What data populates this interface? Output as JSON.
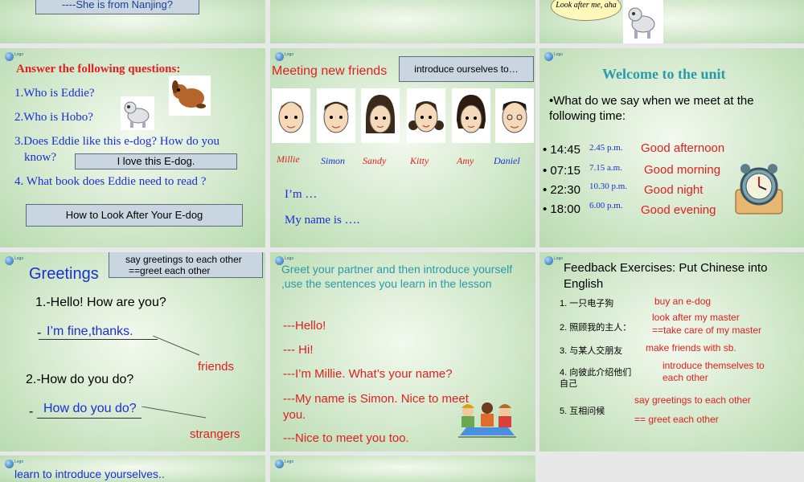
{
  "row0": {
    "s1_line": "----She is  from Nanjing?",
    "s3_bubble": "Look after me, aha"
  },
  "slide_questions": {
    "title": "Answer the following questions:",
    "q1": "1.Who is Eddie?",
    "q2": "2.Who is Hobo?",
    "q3a": "3.Does Eddie like this e-dog? How do you",
    "q3b": "know?",
    "q3_answer": "I love this E-dog.",
    "q4": "4. What book does Eddie need to read ?",
    "q4_answer": "How to Look After Your E-dog"
  },
  "slide_friends": {
    "title": "Meeting new friends",
    "box": "introduce ourselves to…",
    "names": [
      "Millie",
      "Simon",
      "Sandy",
      "Kitty",
      "Amy",
      "Daniel"
    ],
    "line1": "I’m …",
    "line2": "My name is …."
  },
  "slide_welcome": {
    "title": "Welcome to the unit",
    "question": "•What do we say when we meet at the following time:",
    "times": [
      {
        "time": "14:45",
        "note": "2.45 p.m.",
        "greeting": "Good afternoon"
      },
      {
        "time": "07:15",
        "note": "7.15 a.m.",
        "greeting": "Good morning"
      },
      {
        "time": "22:30",
        "note": "10.30 p.m.",
        "greeting": "Good night"
      },
      {
        "time": "18:00",
        "note": "6.00 p.m.",
        "greeting": "Good evening"
      }
    ]
  },
  "slide_greetings": {
    "title": "Greetings",
    "box_line1": "say greetings to each other",
    "box_line2": "==greet each other",
    "q1": "1.-Hello! How are you?",
    "a1": "I’m fine,thanks.",
    "tag1": "friends",
    "q2": "2.-How do you do?",
    "a2": "How do you do?",
    "tag2": "strangers"
  },
  "slide_partner": {
    "instruction": "Greet your partner and then introduce yourself ,use the sentences you learn in the lesson",
    "d1": "---Hello!",
    "d2": "--- Hi!",
    "d3": "---I’m Millie. What’s your name?",
    "d4": "---My name is Simon. Nice to meet you.",
    "d5": "---Nice to meet you too."
  },
  "slide_feedback": {
    "title": "Feedback Exercises: Put Chinese into English",
    "items": [
      {
        "cn": "1. 一只电子狗",
        "en": "buy an e-dog"
      },
      {
        "cn": "2. 照顾我的主人：",
        "en1": "look after my master",
        "en2": "==take care of my master"
      },
      {
        "cn": "3. 与某人交朋友",
        "en": "make friends with sb."
      },
      {
        "cn": "4. 向彼此介绍他们自己",
        "en1": "introduce themselves to",
        "en2": "each other"
      },
      {
        "cn": "5. 互相问候",
        "en1": "say  greetings to each other",
        "en2": "== greet each other"
      }
    ]
  },
  "row3": {
    "s1_line": "learn to introduce yourselves.."
  },
  "colors": {
    "red": "#e0201f",
    "blue": "#1a2fd4",
    "teal": "#2b9aa8",
    "box_fill": "#c9d6e1"
  }
}
